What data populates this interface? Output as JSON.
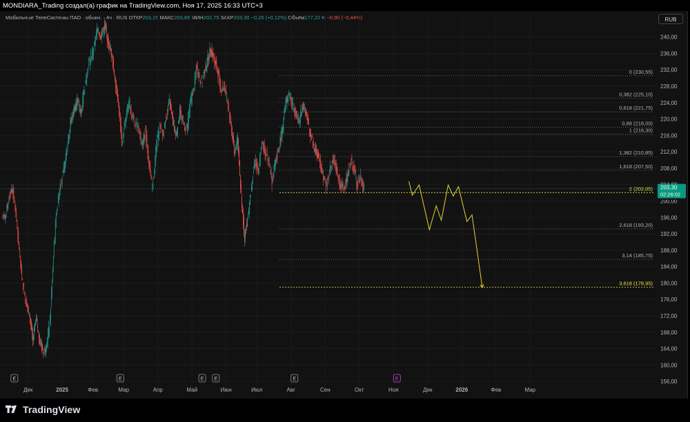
{
  "header": {
    "title": "MONDIARA_Trading создал(а) график на TradingView.com, Ноя 17, 2025 16:33 UTC+3"
  },
  "legend": {
    "symbol": "Мобильные ТелеСистемы ПАО · обыкн. · 4ч · RUS",
    "open_label": "ОТКР",
    "open": "203,15",
    "high_label": "МАКС",
    "high": "203,85",
    "low_label": "МИН",
    "low": "202,75",
    "close_label": "ЗАКР",
    "close": "203,30",
    "change": "−0,25 (+0,12%)",
    "volume_label": "Объём",
    "volume": "177,22 K",
    "volume_change": "−0,90 (−0,44%)"
  },
  "currency_button": "RUB",
  "price_badge": {
    "price": "203,30",
    "countdown": "02:26:02"
  },
  "footer": {
    "brand": "TradingView"
  },
  "colors": {
    "up": "#26a69a",
    "down": "#ef5350",
    "fib_highlight": "#f0e54f",
    "projection": "#e8d535",
    "events": "#c64ee2"
  },
  "chart_data": {
    "type": "candlestick",
    "ylim": [
      154,
      246
    ],
    "y_ticks": [
      156,
      160,
      164,
      168,
      172,
      176,
      180,
      184,
      188,
      192,
      196,
      200,
      204,
      208,
      212,
      216,
      220,
      224,
      228,
      232,
      236,
      240
    ],
    "x_labels": [
      {
        "label": "Дек",
        "i": 7
      },
      {
        "label": "2025",
        "i": 17
      },
      {
        "label": "Фев",
        "i": 26
      },
      {
        "label": "Мар",
        "i": 35
      },
      {
        "label": "Апр",
        "i": 45
      },
      {
        "label": "Май",
        "i": 55
      },
      {
        "label": "Июн",
        "i": 65
      },
      {
        "label": "Июл",
        "i": 74
      },
      {
        "label": "Авг",
        "i": 84
      },
      {
        "label": "Сен",
        "i": 94
      },
      {
        "label": "Окт",
        "i": 104
      },
      {
        "label": "Ноя",
        "i": 114
      },
      {
        "label": "Дек",
        "i": 124
      },
      {
        "label": "2026",
        "i": 134
      },
      {
        "label": "Фев",
        "i": 144
      },
      {
        "label": "Мар",
        "i": 154
      }
    ],
    "closes": [
      196,
      201,
      203,
      197,
      188,
      180,
      176,
      172,
      166,
      171,
      166,
      163,
      165,
      171,
      187,
      198,
      204,
      207,
      213,
      219,
      222,
      225,
      221,
      227,
      232,
      235,
      238,
      242,
      240,
      243,
      239,
      236,
      230,
      224,
      214,
      219,
      224,
      221,
      219,
      217,
      214,
      217,
      209,
      203,
      212,
      218,
      216,
      220,
      224,
      219,
      216,
      222,
      219,
      217,
      224,
      227,
      233,
      229,
      231,
      234,
      237,
      235,
      232,
      227,
      228,
      224,
      219,
      212,
      215,
      201,
      191,
      197,
      203,
      210,
      207,
      214,
      212,
      210,
      205,
      209,
      213,
      217,
      224,
      226,
      223,
      222,
      219,
      224,
      221,
      217,
      214,
      212,
      210,
      206,
      204,
      208,
      210,
      207,
      204,
      203,
      206,
      210,
      208,
      204,
      206,
      203
    ],
    "fib_levels": [
      {
        "label": "0 (230,55)",
        "value": 230.55,
        "highlight": false
      },
      {
        "label": "0,382 (225,10)",
        "value": 225.1,
        "highlight": false
      },
      {
        "label": "0,618 (221,75)",
        "value": 221.75,
        "highlight": false
      },
      {
        "label": "0,88 (218,00)",
        "value": 218.0,
        "highlight": false
      },
      {
        "label": "1 (216,30)",
        "value": 216.3,
        "highlight": false
      },
      {
        "label": "1,382 (210,85)",
        "value": 210.85,
        "highlight": false
      },
      {
        "label": "1,618 (207,50)",
        "value": 207.5,
        "highlight": false
      },
      {
        "label": "2 (202,05)",
        "value": 202.05,
        "highlight": true
      },
      {
        "label": "2,618 (193,20)",
        "value": 193.2,
        "highlight": false
      },
      {
        "label": "3,14 (185,75)",
        "value": 185.75,
        "highlight": false
      },
      {
        "label": "3,618 (178,95)",
        "value": 178.95,
        "highlight": true
      }
    ],
    "projection": [
      {
        "i": 118.5,
        "y": 204.8
      },
      {
        "i": 119.5,
        "y": 201.4
      },
      {
        "i": 121.5,
        "y": 203.9
      },
      {
        "i": 124.5,
        "y": 193.0
      },
      {
        "i": 126.5,
        "y": 198.8
      },
      {
        "i": 128,
        "y": 195.3
      },
      {
        "i": 130,
        "y": 203.9
      },
      {
        "i": 131.5,
        "y": 201.2
      },
      {
        "i": 133,
        "y": 203.5
      },
      {
        "i": 135.5,
        "y": 195.0
      },
      {
        "i": 137,
        "y": 196.6
      },
      {
        "i": 140,
        "y": 178.9
      }
    ],
    "event_markers": [
      {
        "i": 3,
        "label": "E"
      },
      {
        "i": 34,
        "label": "E"
      },
      {
        "i": 58,
        "label": "E"
      },
      {
        "i": 62,
        "label": "E"
      },
      {
        "i": 85,
        "label": "E"
      },
      {
        "i": 115,
        "label": "E"
      }
    ]
  }
}
